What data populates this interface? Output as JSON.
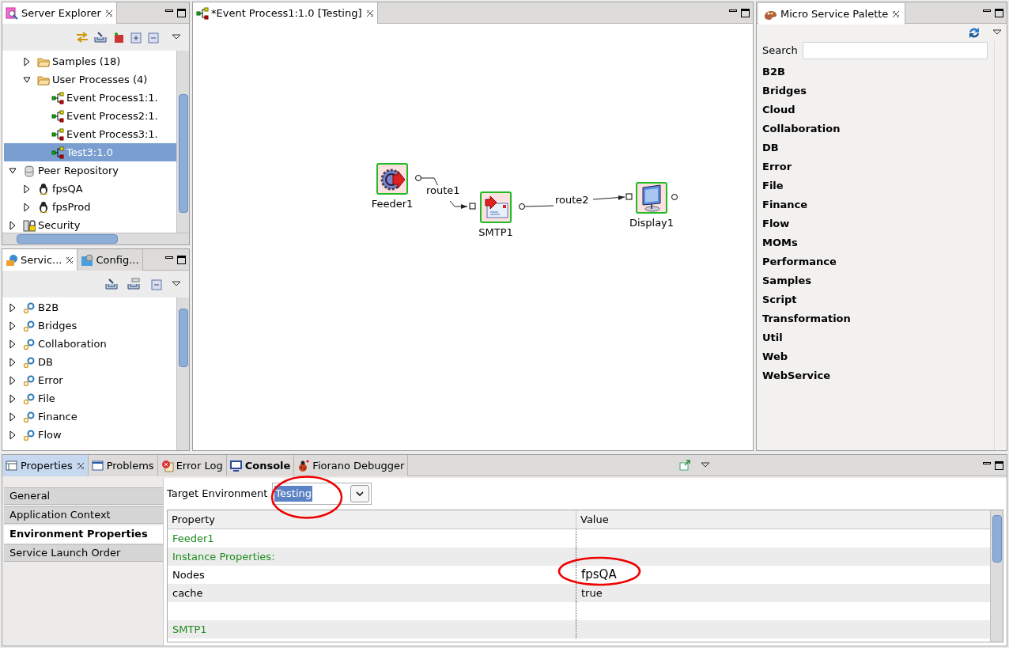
{
  "server_explorer": {
    "title": "Server Explorer",
    "tree": [
      {
        "children": [
          {
            "children": [
              {
                "label": "Samples (18)",
                "kind": "folder",
                "expanded": false,
                "selected": false
              },
              {
                "label": "User Processes (4)",
                "kind": "folder",
                "expanded": true,
                "selected": false,
                "children": [
                  {
                    "label": "Event Process1:1.",
                    "kind": "process",
                    "selected": false
                  },
                  {
                    "label": "Event Process2:1.",
                    "kind": "process",
                    "selected": false
                  },
                  {
                    "label": "Event Process3:1.",
                    "kind": "process",
                    "selected": false
                  },
                  {
                    "label": "Test3:1.0",
                    "kind": "process",
                    "selected": true
                  }
                ]
              }
            ]
          },
          {
            "label": "Peer Repository",
            "kind": "repository",
            "expanded": true,
            "selected": false,
            "children": [
              {
                "label": "fpsQA",
                "kind": "peer",
                "expanded": false,
                "selected": false
              },
              {
                "label": "fpsProd",
                "kind": "peer",
                "expanded": false,
                "selected": false
              }
            ]
          },
          {
            "label": "Security",
            "kind": "security",
            "expanded": false,
            "selected": false
          }
        ]
      }
    ]
  },
  "services_panel": {
    "tabs": [
      {
        "label": "Servic...",
        "selected": true
      },
      {
        "label": "Config...",
        "selected": false
      }
    ],
    "tree": [
      {
        "label": "B2B",
        "expanded": false
      },
      {
        "label": "Bridges",
        "expanded": false
      },
      {
        "label": "Collaboration",
        "expanded": false
      },
      {
        "label": "DB",
        "expanded": false
      },
      {
        "label": "Error",
        "expanded": false
      },
      {
        "label": "File",
        "expanded": false
      },
      {
        "label": "Finance",
        "expanded": false
      },
      {
        "label": "Flow",
        "expanded": false
      }
    ]
  },
  "editor": {
    "title": "*Event Process1:1.0 [Testing]",
    "nodes": [
      {
        "label": "Feeder1",
        "kind": "feeder"
      },
      {
        "label": "SMTP1",
        "kind": "smtp"
      },
      {
        "label": "Display1",
        "kind": "display"
      }
    ],
    "routes": [
      {
        "label": "route1"
      },
      {
        "label": "route2"
      }
    ]
  },
  "palette": {
    "title": "Micro Service Palette",
    "search": {
      "label": "Search"
    },
    "categories": [
      "B2B",
      "Bridges",
      "Cloud",
      "Collaboration",
      "DB",
      "Error",
      "File",
      "Finance",
      "Flow",
      "MOMs",
      "Performance",
      "Samples",
      "Script",
      "Transformation",
      "Util",
      "Web",
      "WebService"
    ]
  },
  "properties_panel": {
    "tabs": [
      {
        "label": "Properties",
        "kind": "properties",
        "selected": true,
        "emphasized": false
      },
      {
        "label": "Problems",
        "kind": "problems",
        "selected": false,
        "emphasized": false
      },
      {
        "label": "Error Log",
        "kind": "errorlog",
        "selected": false,
        "emphasized": false
      },
      {
        "label": "Console",
        "kind": "console",
        "selected": false,
        "emphasized": true
      },
      {
        "label": "Fiorano Debugger",
        "kind": "debugger",
        "selected": false,
        "emphasized": false
      }
    ],
    "sections": [
      {
        "label": "General",
        "selected": false
      },
      {
        "label": "Application Context",
        "selected": false
      },
      {
        "label": "Environment Properties",
        "selected": true
      },
      {
        "label": "Service Launch Order",
        "selected": false
      }
    ],
    "target_environment": {
      "label": "Target Environment",
      "value": "Testing"
    },
    "table": {
      "columns": [
        "Property",
        "Value"
      ],
      "rows": [
        {
          "kind": "group",
          "property": "Feeder1"
        },
        {
          "kind": "group",
          "property": "Instance Properties:"
        },
        {
          "kind": "property",
          "property": "Nodes",
          "value": "fpsQA"
        },
        {
          "kind": "property",
          "property": "cache",
          "value": "true"
        },
        {
          "kind": "empty"
        },
        {
          "kind": "group",
          "property": "SMTP1"
        }
      ]
    }
  }
}
